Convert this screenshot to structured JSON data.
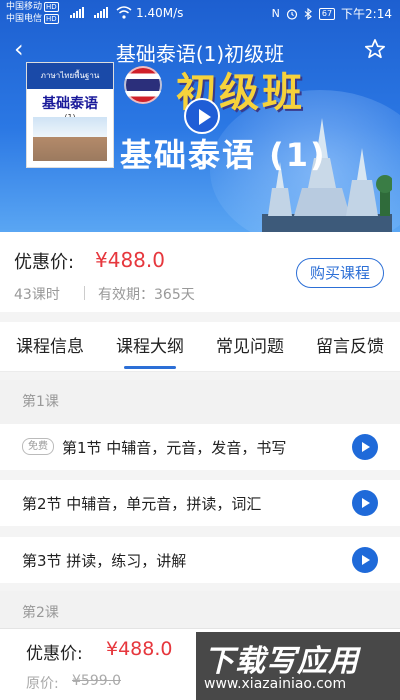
{
  "status_bar": {
    "carrier1": "中国移动",
    "carrier2": "中国电信",
    "hd_badge": "HD",
    "speed": "1.40M/s",
    "nfc": "N",
    "alarm_icon": "alarm-icon",
    "bluetooth_icon": "bluetooth-icon",
    "battery": "67",
    "time": "下午2:14"
  },
  "header": {
    "back_icon": "‹",
    "title": "基础泰语(1)初级班",
    "favorite_icon": "star-outline-icon"
  },
  "banner": {
    "book_top_text": "ภาษาไทยพื้นฐาน",
    "book_title": "基础泰语",
    "book_volume": "(1)",
    "headline": "初级班",
    "subline": "基础泰语 (1)"
  },
  "course": {
    "price_label": "优惠价:",
    "price": "¥488.0",
    "lesson_count": "43课时",
    "validity": "有效期：365天",
    "buy_button": "购买课程"
  },
  "tabs": [
    {
      "label": "课程信息",
      "active": false
    },
    {
      "label": "课程大纲",
      "active": true
    },
    {
      "label": "常见问题",
      "active": false
    },
    {
      "label": "留言反馈",
      "active": false
    }
  ],
  "syllabus": {
    "groups": [
      {
        "title": "第1课",
        "lessons": [
          {
            "title": "第1节 中辅音，元音，发音，书写",
            "free_tag": "免费"
          },
          {
            "title": "第2节 中辅音，单元音，拼读，词汇"
          },
          {
            "title": "第3节 拼读，练习，讲解"
          }
        ]
      },
      {
        "title": "第2课",
        "lessons": []
      }
    ]
  },
  "bottom_bar": {
    "price_label": "优惠价:",
    "price": "¥488.0",
    "original_label": "原价:",
    "original_price": "¥599.0"
  },
  "watermark": {
    "text": "下载写应用",
    "url": "www.xiazainiao.com"
  },
  "colors": {
    "accent": "#2c6fd6",
    "price_red": "#e6373d",
    "banner_blue": "#2b78e4"
  }
}
